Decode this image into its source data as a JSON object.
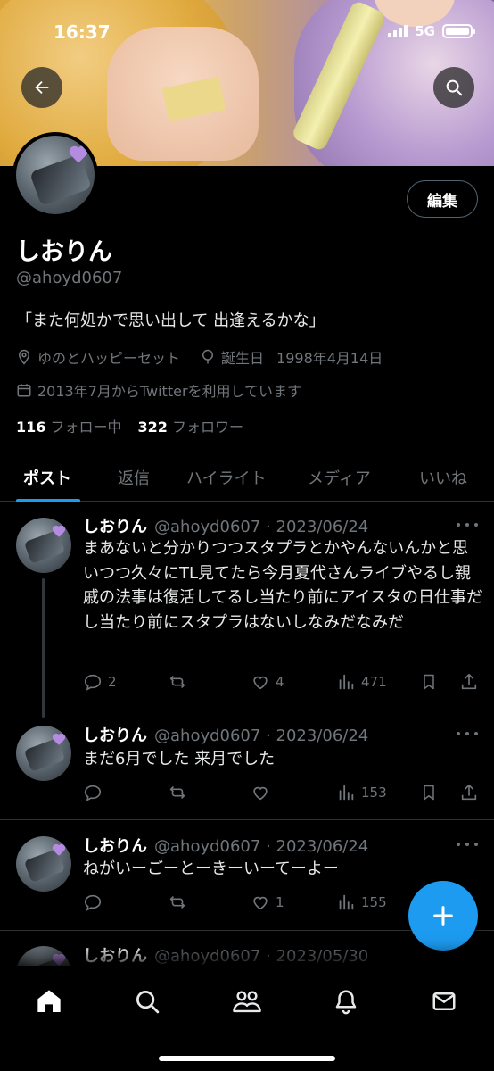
{
  "status_bar": {
    "time": "16:37",
    "network": "5G"
  },
  "profile": {
    "display_name": "しおりん",
    "handle": "@ahoyd0607",
    "edit_label": "編集",
    "bio": "「また何処かで思い出して 出逢えるかな」",
    "location": "ゆのとハッピーセット",
    "birthday_label": "誕生日",
    "birthday": "1998年4月14日",
    "joined": "2013年7月からTwitterを利用しています",
    "following_count": "116",
    "following_label": "フォロー中",
    "followers_count": "322",
    "followers_label": "フォロワー"
  },
  "tabs": [
    {
      "label": "ポスト",
      "active": true
    },
    {
      "label": "返信",
      "active": false
    },
    {
      "label": "ハイライト",
      "active": false
    },
    {
      "label": "メディア",
      "active": false
    },
    {
      "label": "いいね",
      "active": false
    }
  ],
  "posts": [
    {
      "name": "しおりん",
      "handle_date": "@ahoyd0607 · 2023/06/24",
      "text": "まあないと分かりつつスタプラとかやんないんかと思いつつ久々にTL見てたら今月夏代さんライブやるし親戚の法事は復活してるし当たり前にアイスタの日仕事だし当たり前にスタプラはないしなみだなみだ",
      "replies": "2",
      "retweets": "",
      "likes": "4",
      "views": "471"
    },
    {
      "name": "しおりん",
      "handle_date": "@ahoyd0607 · 2023/06/24",
      "text": "まだ6月でした 来月でした",
      "replies": "",
      "retweets": "",
      "likes": "",
      "views": "153"
    },
    {
      "name": "しおりん",
      "handle_date": "@ahoyd0607 · 2023/06/24",
      "text": "ねがいーごーとーきーいーてーよー",
      "replies": "",
      "retweets": "",
      "likes": "1",
      "views": "155"
    },
    {
      "name": "しおりん",
      "handle_date": "@ahoyd0607 · 2023/05/30",
      "text": "",
      "replies": "",
      "retweets": "",
      "likes": "",
      "views": ""
    }
  ],
  "colors": {
    "accent": "#1d9bf0",
    "background": "#000000",
    "muted": "#71767b",
    "border": "#2f3336"
  },
  "icons": [
    "back-arrow-icon",
    "search-icon",
    "location-pin-icon",
    "balloon-icon",
    "calendar-icon",
    "reply-icon",
    "retweet-icon",
    "like-icon",
    "views-icon",
    "bookmark-icon",
    "share-icon",
    "plus-icon",
    "home-icon",
    "explore-icon",
    "communities-icon",
    "notifications-icon",
    "messages-icon"
  ]
}
